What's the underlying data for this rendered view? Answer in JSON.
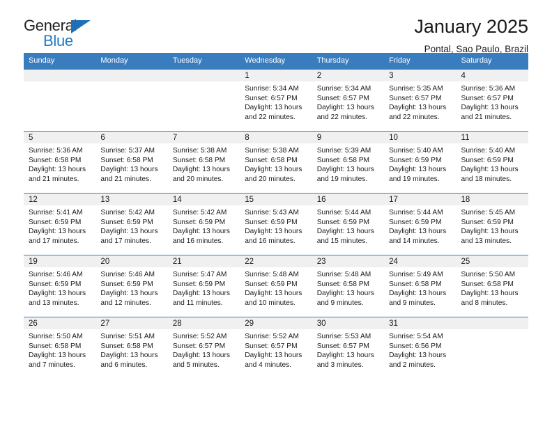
{
  "logo": {
    "word_one": "General",
    "word_two": "Blue",
    "triangle_color": "#1f6fb8",
    "blue_color": "#1f7ac4"
  },
  "header": {
    "title": "January 2025",
    "subtitle": "Pontal, Sao Paulo, Brazil"
  },
  "theme": {
    "header_bg": "#3a7dbf",
    "daynum_bg": "#f0f0f0",
    "text": "#1a1a1a"
  },
  "weekdays": [
    "Sunday",
    "Monday",
    "Tuesday",
    "Wednesday",
    "Thursday",
    "Friday",
    "Saturday"
  ],
  "weeks": [
    [
      {
        "day": "",
        "sunrise": "",
        "sunset": "",
        "daylight_1": "",
        "daylight_2": ""
      },
      {
        "day": "",
        "sunrise": "",
        "sunset": "",
        "daylight_1": "",
        "daylight_2": ""
      },
      {
        "day": "",
        "sunrise": "",
        "sunset": "",
        "daylight_1": "",
        "daylight_2": ""
      },
      {
        "day": "1",
        "sunrise": "Sunrise: 5:34 AM",
        "sunset": "Sunset: 6:57 PM",
        "daylight_1": "Daylight: 13 hours",
        "daylight_2": "and 22 minutes."
      },
      {
        "day": "2",
        "sunrise": "Sunrise: 5:34 AM",
        "sunset": "Sunset: 6:57 PM",
        "daylight_1": "Daylight: 13 hours",
        "daylight_2": "and 22 minutes."
      },
      {
        "day": "3",
        "sunrise": "Sunrise: 5:35 AM",
        "sunset": "Sunset: 6:57 PM",
        "daylight_1": "Daylight: 13 hours",
        "daylight_2": "and 22 minutes."
      },
      {
        "day": "4",
        "sunrise": "Sunrise: 5:36 AM",
        "sunset": "Sunset: 6:57 PM",
        "daylight_1": "Daylight: 13 hours",
        "daylight_2": "and 21 minutes."
      }
    ],
    [
      {
        "day": "5",
        "sunrise": "Sunrise: 5:36 AM",
        "sunset": "Sunset: 6:58 PM",
        "daylight_1": "Daylight: 13 hours",
        "daylight_2": "and 21 minutes."
      },
      {
        "day": "6",
        "sunrise": "Sunrise: 5:37 AM",
        "sunset": "Sunset: 6:58 PM",
        "daylight_1": "Daylight: 13 hours",
        "daylight_2": "and 21 minutes."
      },
      {
        "day": "7",
        "sunrise": "Sunrise: 5:38 AM",
        "sunset": "Sunset: 6:58 PM",
        "daylight_1": "Daylight: 13 hours",
        "daylight_2": "and 20 minutes."
      },
      {
        "day": "8",
        "sunrise": "Sunrise: 5:38 AM",
        "sunset": "Sunset: 6:58 PM",
        "daylight_1": "Daylight: 13 hours",
        "daylight_2": "and 20 minutes."
      },
      {
        "day": "9",
        "sunrise": "Sunrise: 5:39 AM",
        "sunset": "Sunset: 6:58 PM",
        "daylight_1": "Daylight: 13 hours",
        "daylight_2": "and 19 minutes."
      },
      {
        "day": "10",
        "sunrise": "Sunrise: 5:40 AM",
        "sunset": "Sunset: 6:59 PM",
        "daylight_1": "Daylight: 13 hours",
        "daylight_2": "and 19 minutes."
      },
      {
        "day": "11",
        "sunrise": "Sunrise: 5:40 AM",
        "sunset": "Sunset: 6:59 PM",
        "daylight_1": "Daylight: 13 hours",
        "daylight_2": "and 18 minutes."
      }
    ],
    [
      {
        "day": "12",
        "sunrise": "Sunrise: 5:41 AM",
        "sunset": "Sunset: 6:59 PM",
        "daylight_1": "Daylight: 13 hours",
        "daylight_2": "and 17 minutes."
      },
      {
        "day": "13",
        "sunrise": "Sunrise: 5:42 AM",
        "sunset": "Sunset: 6:59 PM",
        "daylight_1": "Daylight: 13 hours",
        "daylight_2": "and 17 minutes."
      },
      {
        "day": "14",
        "sunrise": "Sunrise: 5:42 AM",
        "sunset": "Sunset: 6:59 PM",
        "daylight_1": "Daylight: 13 hours",
        "daylight_2": "and 16 minutes."
      },
      {
        "day": "15",
        "sunrise": "Sunrise: 5:43 AM",
        "sunset": "Sunset: 6:59 PM",
        "daylight_1": "Daylight: 13 hours",
        "daylight_2": "and 16 minutes."
      },
      {
        "day": "16",
        "sunrise": "Sunrise: 5:44 AM",
        "sunset": "Sunset: 6:59 PM",
        "daylight_1": "Daylight: 13 hours",
        "daylight_2": "and 15 minutes."
      },
      {
        "day": "17",
        "sunrise": "Sunrise: 5:44 AM",
        "sunset": "Sunset: 6:59 PM",
        "daylight_1": "Daylight: 13 hours",
        "daylight_2": "and 14 minutes."
      },
      {
        "day": "18",
        "sunrise": "Sunrise: 5:45 AM",
        "sunset": "Sunset: 6:59 PM",
        "daylight_1": "Daylight: 13 hours",
        "daylight_2": "and 13 minutes."
      }
    ],
    [
      {
        "day": "19",
        "sunrise": "Sunrise: 5:46 AM",
        "sunset": "Sunset: 6:59 PM",
        "daylight_1": "Daylight: 13 hours",
        "daylight_2": "and 13 minutes."
      },
      {
        "day": "20",
        "sunrise": "Sunrise: 5:46 AM",
        "sunset": "Sunset: 6:59 PM",
        "daylight_1": "Daylight: 13 hours",
        "daylight_2": "and 12 minutes."
      },
      {
        "day": "21",
        "sunrise": "Sunrise: 5:47 AM",
        "sunset": "Sunset: 6:59 PM",
        "daylight_1": "Daylight: 13 hours",
        "daylight_2": "and 11 minutes."
      },
      {
        "day": "22",
        "sunrise": "Sunrise: 5:48 AM",
        "sunset": "Sunset: 6:59 PM",
        "daylight_1": "Daylight: 13 hours",
        "daylight_2": "and 10 minutes."
      },
      {
        "day": "23",
        "sunrise": "Sunrise: 5:48 AM",
        "sunset": "Sunset: 6:58 PM",
        "daylight_1": "Daylight: 13 hours",
        "daylight_2": "and 9 minutes."
      },
      {
        "day": "24",
        "sunrise": "Sunrise: 5:49 AM",
        "sunset": "Sunset: 6:58 PM",
        "daylight_1": "Daylight: 13 hours",
        "daylight_2": "and 9 minutes."
      },
      {
        "day": "25",
        "sunrise": "Sunrise: 5:50 AM",
        "sunset": "Sunset: 6:58 PM",
        "daylight_1": "Daylight: 13 hours",
        "daylight_2": "and 8 minutes."
      }
    ],
    [
      {
        "day": "26",
        "sunrise": "Sunrise: 5:50 AM",
        "sunset": "Sunset: 6:58 PM",
        "daylight_1": "Daylight: 13 hours",
        "daylight_2": "and 7 minutes."
      },
      {
        "day": "27",
        "sunrise": "Sunrise: 5:51 AM",
        "sunset": "Sunset: 6:58 PM",
        "daylight_1": "Daylight: 13 hours",
        "daylight_2": "and 6 minutes."
      },
      {
        "day": "28",
        "sunrise": "Sunrise: 5:52 AM",
        "sunset": "Sunset: 6:57 PM",
        "daylight_1": "Daylight: 13 hours",
        "daylight_2": "and 5 minutes."
      },
      {
        "day": "29",
        "sunrise": "Sunrise: 5:52 AM",
        "sunset": "Sunset: 6:57 PM",
        "daylight_1": "Daylight: 13 hours",
        "daylight_2": "and 4 minutes."
      },
      {
        "day": "30",
        "sunrise": "Sunrise: 5:53 AM",
        "sunset": "Sunset: 6:57 PM",
        "daylight_1": "Daylight: 13 hours",
        "daylight_2": "and 3 minutes."
      },
      {
        "day": "31",
        "sunrise": "Sunrise: 5:54 AM",
        "sunset": "Sunset: 6:56 PM",
        "daylight_1": "Daylight: 13 hours",
        "daylight_2": "and 2 minutes."
      },
      {
        "day": "",
        "sunrise": "",
        "sunset": "",
        "daylight_1": "",
        "daylight_2": ""
      }
    ]
  ]
}
